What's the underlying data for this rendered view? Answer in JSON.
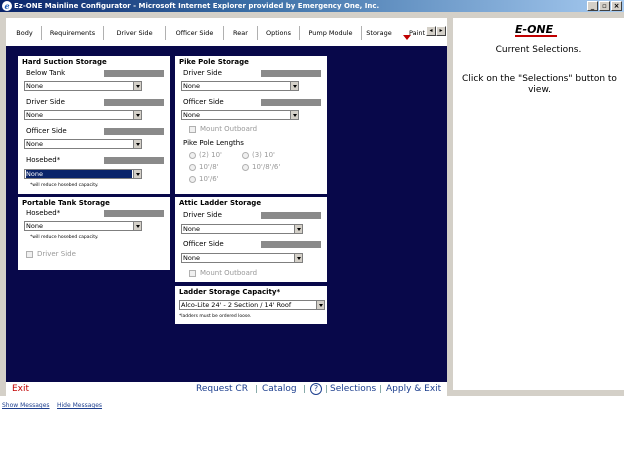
{
  "window": {
    "title": "Ez-ONE Mainline Configurator - Microsoft Internet Explorer provided by Emergency One, Inc.",
    "minimize": "_",
    "restore": "▫",
    "close": "×"
  },
  "tabs": [
    "Body",
    "Requirements",
    "Driver Side",
    "Officer Side",
    "Rear",
    "Options",
    "Pump Module",
    "Storage",
    "Paint"
  ],
  "active_tab": "Storage",
  "tab_scroll": {
    "left": "◂",
    "right": "▸"
  },
  "hard_suction": {
    "title": "Hard Suction Storage",
    "below_tank": {
      "label": "Below Tank",
      "value": "None"
    },
    "driver_side": {
      "label": "Driver Side",
      "value": "None"
    },
    "officer_side": {
      "label": "Officer Side",
      "value": "None"
    },
    "hosebed": {
      "label": "Hosebed*",
      "value": "None",
      "note": "*will reduce hosebed capacity."
    }
  },
  "portable_tank": {
    "title": "Portable Tank Storage",
    "hosebed": {
      "label": "Hosebed*",
      "value": "None",
      "note": "*will reduce hosebed capacity."
    },
    "driver_side_checkbox": "Driver Side"
  },
  "pike_pole": {
    "title": "Pike Pole Storage",
    "driver_side": {
      "label": "Driver Side",
      "value": "None"
    },
    "officer_side": {
      "label": "Officer Side",
      "value": "None"
    },
    "mount_outboard": "Mount Outboard",
    "lengths_label": "Pike Pole Lengths",
    "lengths": [
      "(2) 10'",
      "(3) 10'",
      "10'/8'",
      "10'/8'/6'",
      "10'/6'"
    ]
  },
  "attic_ladder": {
    "title": "Attic Ladder Storage",
    "driver_side": {
      "label": "Driver Side",
      "value": "None"
    },
    "officer_side": {
      "label": "Officer Side",
      "value": "None"
    },
    "mount_outboard": "Mount Outboard"
  },
  "ladder_capacity": {
    "title": "Ladder Storage Capacity*",
    "value": "Alco-Lite 24' - 2 Section / 14' Roof",
    "note": "*ladders must be ordered loose."
  },
  "bottom_bar": {
    "exit": "Exit",
    "request_cr": "Request CR",
    "catalog": "Catalog",
    "help": "?",
    "selections": "Selections",
    "apply_exit": "Apply & Exit"
  },
  "side_panel": {
    "logo": "E-ONE",
    "current": "Current Selections.",
    "instructions": "Click on the \"Selections\" button to view."
  },
  "messages": {
    "show": "Show Messages",
    "hide": "Hide Messages"
  },
  "colors": {
    "canvas": "#08084a",
    "accent": "#c00000",
    "link": "#1c3e8e"
  }
}
